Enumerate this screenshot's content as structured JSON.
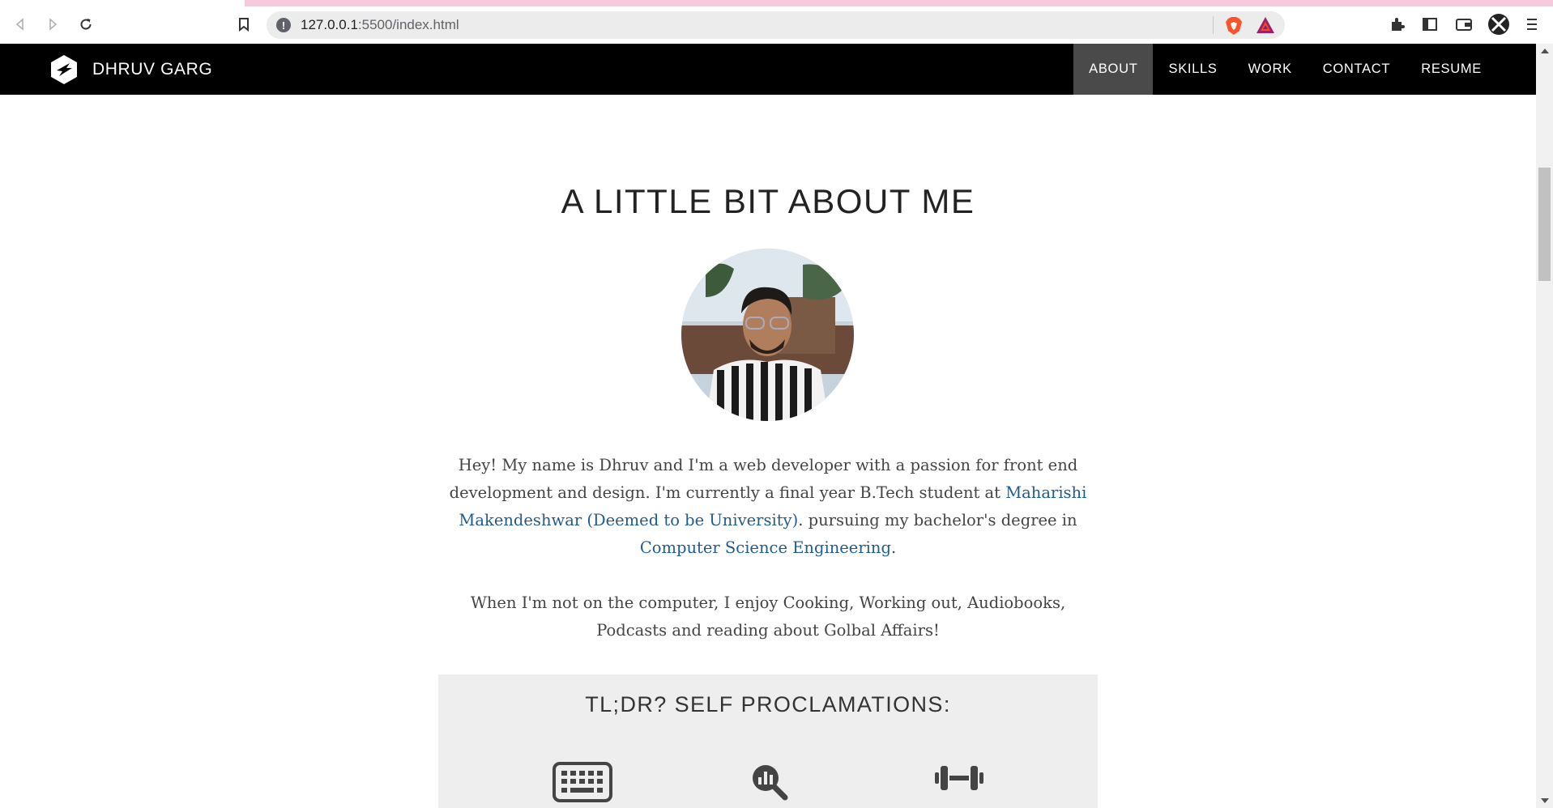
{
  "browser": {
    "url_host": "127.0.0.1",
    "url_path": ":5500/index.html"
  },
  "site": {
    "brand": "DHRUV GARG",
    "menu": [
      {
        "label": "ABOUT",
        "active": true
      },
      {
        "label": "SKILLS",
        "active": false
      },
      {
        "label": "WORK",
        "active": false
      },
      {
        "label": "CONTACT",
        "active": false
      },
      {
        "label": "RESUME",
        "active": false
      }
    ]
  },
  "about": {
    "title": "A LITTLE BIT ABOUT ME",
    "bio_p1": {
      "t1": "Hey! My name is Dhruv and I'm a web developer with a passion for front end development and design. I'm currently a final year B.Tech student at ",
      "link1": "Maharishi Makendeshwar (Deemed to be University)",
      "t2": ". pursuing my bachelor's degree in ",
      "link2": "Computer Science Engineering",
      "t3": "."
    },
    "bio_p2": "When I'm not on the computer, I enjoy Cooking, Working out, Audiobooks, Podcasts and reading about Golbal Affairs!"
  },
  "tldr": {
    "title": "TL;DR?  SELF PROCLAMATIONS:",
    "icons": [
      "keyboard-icon",
      "magnifier-chart-icon",
      "dumbbell-icon"
    ]
  },
  "colors": {
    "nav_bg": "#000000",
    "nav_active": "#4a4a4a",
    "link": "#1f5b8f",
    "tldr_bg": "#eeeeee",
    "loadbar": "#f7c9dc"
  }
}
